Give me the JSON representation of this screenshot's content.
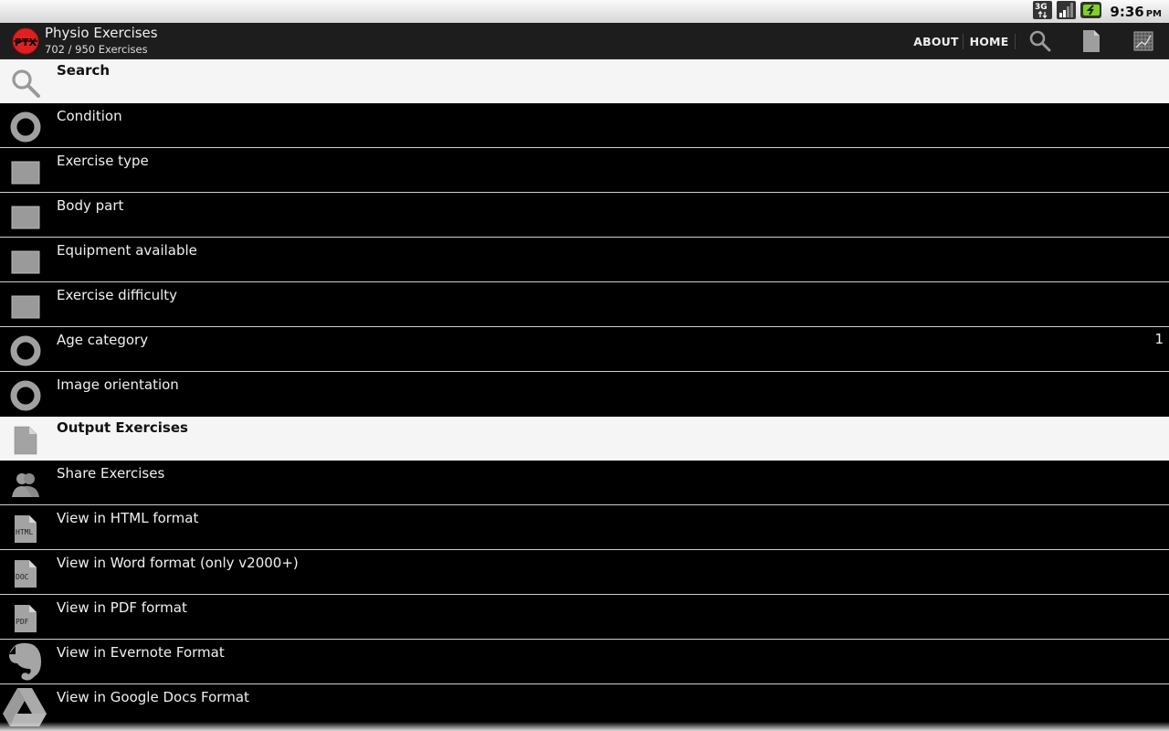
{
  "status_bar": {
    "network": "3G",
    "time": "9:36",
    "ampm": "PM"
  },
  "action_bar": {
    "logo_text": "PTX",
    "title": "Physio Exercises",
    "subtitle": "702 / 950 Exercises",
    "buttons": [
      {
        "label": "ABOUT"
      },
      {
        "label": "HOME"
      }
    ],
    "icons": [
      "search-icon",
      "document-icon",
      "grid-chart-icon"
    ]
  },
  "list": {
    "sections": [
      {
        "header": {
          "label": "Search",
          "icon": "search-icon"
        },
        "items": [
          {
            "label": "Condition",
            "icon": "radio-ring-icon",
            "count": ""
          },
          {
            "label": "Exercise type",
            "icon": "checkbox-icon",
            "count": ""
          },
          {
            "label": "Body part",
            "icon": "checkbox-icon",
            "count": ""
          },
          {
            "label": "Equipment available",
            "icon": "checkbox-icon",
            "count": ""
          },
          {
            "label": "Exercise difficulty",
            "icon": "checkbox-icon",
            "count": ""
          },
          {
            "label": "Age category",
            "icon": "radio-ring-icon",
            "count": "1"
          },
          {
            "label": "Image orientation",
            "icon": "radio-ring-icon",
            "count": ""
          }
        ]
      },
      {
        "header": {
          "label": "Output Exercises",
          "icon": "document-icon"
        },
        "items": [
          {
            "label": "Share Exercises",
            "icon": "people-icon"
          },
          {
            "label": "View in HTML format",
            "icon": "html-file-icon",
            "file_tag": "HTML"
          },
          {
            "label": "View in Word format (only v2000+)",
            "icon": "doc-file-icon",
            "file_tag": "DOC"
          },
          {
            "label": "View in PDF format",
            "icon": "pdf-file-icon",
            "file_tag": "PDF"
          },
          {
            "label": "View in Evernote Format",
            "icon": "evernote-icon"
          },
          {
            "label": "View in Google Docs Format",
            "icon": "google-drive-icon"
          }
        ]
      }
    ]
  },
  "colors": {
    "logo_red": "#e02020",
    "actionbar_bg": "#1d1d1d",
    "header_row_bg": "#f5f5f5",
    "list_bg": "#000000",
    "icon_gray": "#9a9a9a",
    "battery_green": "#7ed321"
  }
}
